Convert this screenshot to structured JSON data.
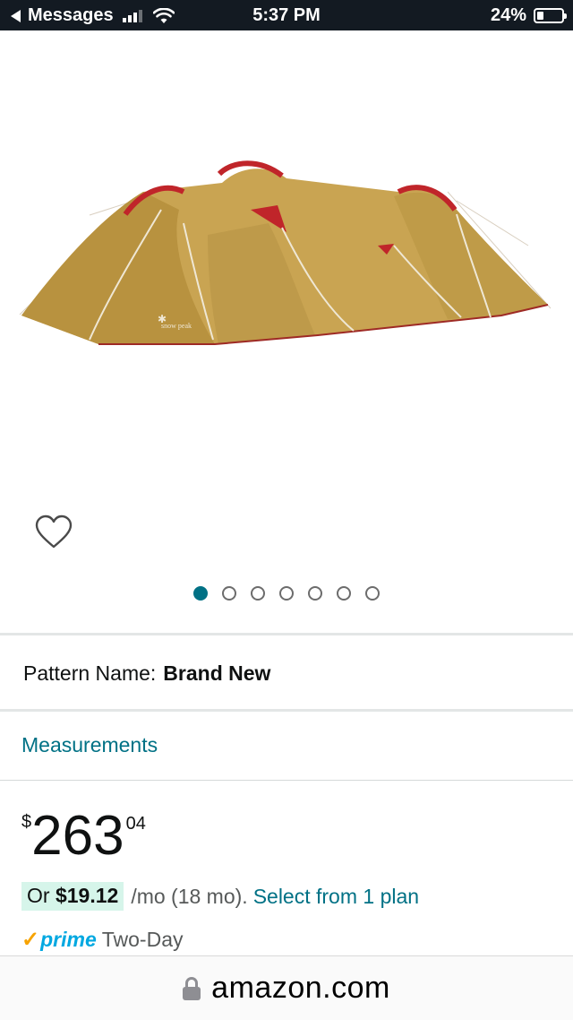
{
  "status_bar": {
    "back_label": "Messages",
    "time": "5:37 PM",
    "battery_percent": "24%",
    "battery_level": 0.24,
    "signal_bars": 3,
    "icons": [
      "back-arrow-icon",
      "signal-icon",
      "wifi-icon",
      "battery-icon"
    ]
  },
  "product": {
    "image_description_icon": "tent-image",
    "image_brand_mark": "snow peak",
    "wishlist_icon": "heart-outline-icon",
    "carousel": {
      "total": 7,
      "active_index": 0
    },
    "pattern_name_label": "Pattern Name:",
    "pattern_name_value": "Brand New",
    "measurements_link": "Measurements",
    "price": {
      "currency": "$",
      "whole": "263",
      "fraction": "04"
    },
    "installment": {
      "or_text": "Or",
      "monthly_amount": "$19.12",
      "per_month_text": "/mo (18 mo).",
      "select_plan_link": "Select from 1 plan"
    },
    "prime": {
      "check": "✓",
      "label": "prime",
      "delivery": "Two-Day"
    }
  },
  "browser": {
    "url": "amazon.com",
    "lock_icon": "lock-icon"
  },
  "colors": {
    "status_bar_bg": "#131a22",
    "link": "#007185",
    "carousel_active": "#007185",
    "installment_bg": "#d6f5ea",
    "prime_blue": "#00a8e1",
    "prime_check": "#f7a300",
    "tent_body": "#c9a452",
    "tent_trim": "#c0252a"
  }
}
